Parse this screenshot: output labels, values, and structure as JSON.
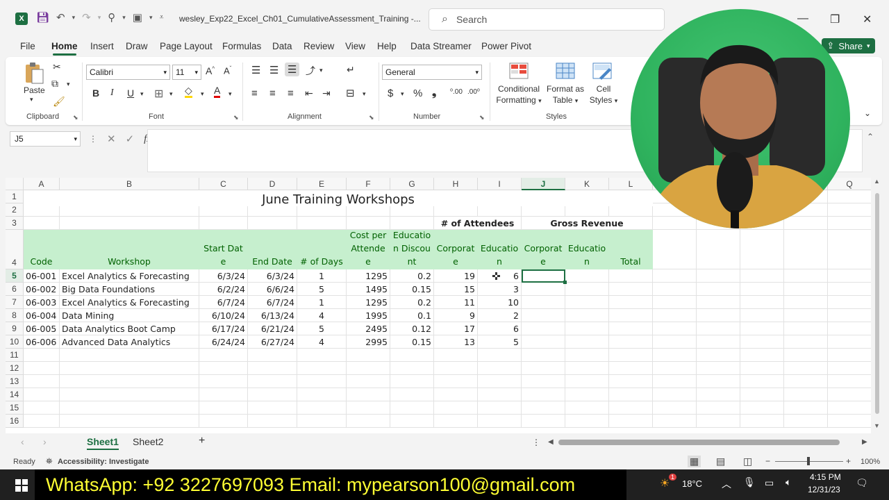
{
  "titlebar": {
    "doc_title": "wesley_Exp22_Excel_Ch01_CumulativeAssessment_Training  -...",
    "search_placeholder": "Search"
  },
  "menu": {
    "tabs": [
      "File",
      "Home",
      "Insert",
      "Draw",
      "Page Layout",
      "Formulas",
      "Data",
      "Review",
      "View",
      "Help",
      "Data Streamer",
      "Power Pivot"
    ],
    "active": "Home",
    "share_label": "Share"
  },
  "ribbon": {
    "clipboard": {
      "paste_label": "Paste",
      "group_label": "Clipboard"
    },
    "font": {
      "name": "Calibri",
      "size": "11",
      "group_label": "Font"
    },
    "alignment": {
      "group_label": "Alignment"
    },
    "number": {
      "format": "General",
      "group_label": "Number"
    },
    "styles": {
      "conditional_1": "Conditional",
      "conditional_2": "Formatting",
      "format_table_1": "Format as",
      "format_table_2": "Table",
      "cell_styles_1": "Cell",
      "cell_styles_2": "Styles",
      "group_label": "Styles"
    }
  },
  "formula_bar": {
    "name_box": "J5",
    "formula": ""
  },
  "grid": {
    "columns": [
      "A",
      "B",
      "C",
      "D",
      "E",
      "F",
      "G",
      "H",
      "I",
      "J",
      "K",
      "L",
      "M",
      "N",
      "O",
      "P",
      "Q"
    ],
    "selected_column": "J",
    "rows": [
      "1",
      "2",
      "3",
      "4",
      "5",
      "6",
      "7",
      "8",
      "9",
      "10",
      "11",
      "12",
      "13",
      "14",
      "15",
      "16"
    ],
    "selected_row": "5",
    "title": "June Training Workshops",
    "attendees_label": "# of Attendees",
    "revenue_label": "Gross Revenue",
    "headers": [
      "Code",
      "Workshop",
      "Start Date",
      "End Date",
      "# of Days",
      "Cost per Attendee",
      "Educatio n Discount",
      "Corporat e",
      "Educatio n",
      "Corporat e",
      "Educatio n",
      "Total"
    ],
    "data": [
      [
        "06-001",
        "Excel Analytics & Forecasting",
        "6/3/24",
        "6/3/24",
        "1",
        "1295",
        "0.2",
        "19",
        "6"
      ],
      [
        "06-002",
        "Big Data Foundations",
        "6/2/24",
        "6/6/24",
        "5",
        "1495",
        "0.15",
        "15",
        "3"
      ],
      [
        "06-003",
        "Excel Analytics & Forecasting",
        "6/7/24",
        "6/7/24",
        "1",
        "1295",
        "0.2",
        "11",
        "10"
      ],
      [
        "06-004",
        "Data Mining",
        "6/10/24",
        "6/13/24",
        "4",
        "1995",
        "0.1",
        "9",
        "2"
      ],
      [
        "06-005",
        "Data Analytics Boot Camp",
        "6/17/24",
        "6/21/24",
        "5",
        "2495",
        "0.12",
        "17",
        "6"
      ],
      [
        "06-006",
        "Advanced Data Analytics",
        "6/24/24",
        "6/27/24",
        "4",
        "2995",
        "0.15",
        "13",
        "5"
      ]
    ]
  },
  "sheets": {
    "tabs": [
      "Sheet1",
      "Sheet2"
    ],
    "active": "Sheet1"
  },
  "status": {
    "ready": "Ready",
    "accessibility": "Accessibility: Investigate",
    "zoom": "100%"
  },
  "taskbar": {
    "banner": "WhatsApp: +92 3227697093  Email: mypearson100@gmail.com",
    "temperature": "18°C",
    "time": "4:15 PM",
    "date": "12/31/23",
    "weather_badge": "1"
  },
  "colors": {
    "excel_green": "#1d6f42",
    "header_fill": "#c6efce",
    "header_text": "#006100",
    "banner_text": "#ffff33"
  }
}
